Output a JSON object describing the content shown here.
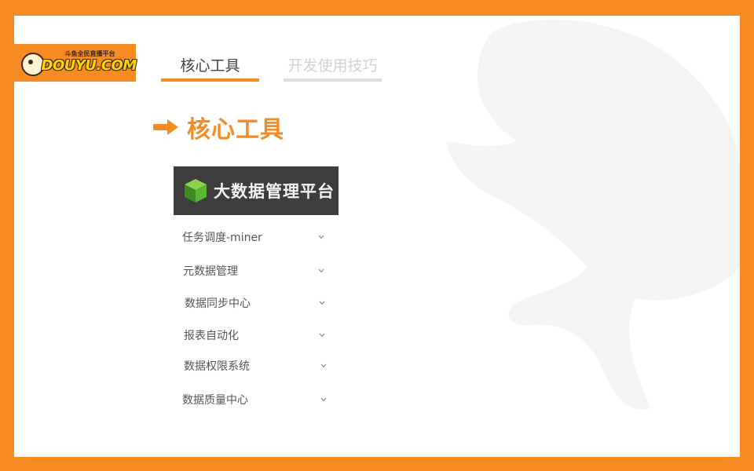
{
  "logo": {
    "brand": "DOUYU.COM",
    "slogan": "斗鱼全民直播平台"
  },
  "tabs": [
    {
      "label": "核心工具",
      "active": true
    },
    {
      "label": "开发使用技巧",
      "active": false
    }
  ],
  "section": {
    "title": "核心工具"
  },
  "platform": {
    "title": "大数据管理平台"
  },
  "menu": [
    {
      "label": "任务调度-miner"
    },
    {
      "label": "元数据管理"
    },
    {
      "label": "数据同步中心"
    },
    {
      "label": "报表自动化"
    },
    {
      "label": "数据权限系统"
    },
    {
      "label": "数据质量中心"
    }
  ],
  "colors": {
    "accent": "#f68b24",
    "banner": "#3d3d3d",
    "cube": "#55b030"
  }
}
